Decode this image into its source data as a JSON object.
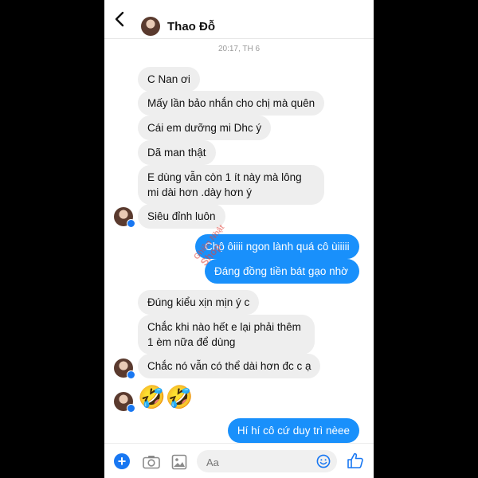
{
  "header": {
    "contact_name": "Thao Đỗ"
  },
  "timestamp": "20:17, TH 6",
  "messages": [
    {
      "text": "C Nan ơi"
    },
    {
      "text": "Mấy lần bảo nhắn cho chị mà quên"
    },
    {
      "text": "Cái em dưỡng mi Dhc ý"
    },
    {
      "text": "Dã man thật"
    },
    {
      "text": "E dùng vẫn còn 1 ít này mà lông mi dài hơn .dày hơn ý"
    },
    {
      "text": "Siêu đỉnh luôn"
    },
    {
      "text": "Chộ ôiiii ngon lành quá cô ùiiiii"
    },
    {
      "text": "Đáng đồng tiền bát gạo nhờ"
    },
    {
      "text": "Đúng kiểu xịn mịn ý c"
    },
    {
      "text": "Chắc khi nào hết e lại phải thêm 1 èm nữa để dùng"
    },
    {
      "text": "Chắc nó vẫn có thể dài hơn đc c ạ"
    },
    {
      "text": "🤣🤣"
    },
    {
      "text": "Hí hí cô cứ duy trì nèee"
    }
  ],
  "watermark": {
    "line1": "Ghiền Nhật",
    "line2": "Shop"
  },
  "composer": {
    "placeholder": "Aa"
  },
  "colors": {
    "outgoing": "#1990fb",
    "incoming": "#eeeeee",
    "accent": "#1877f2"
  }
}
